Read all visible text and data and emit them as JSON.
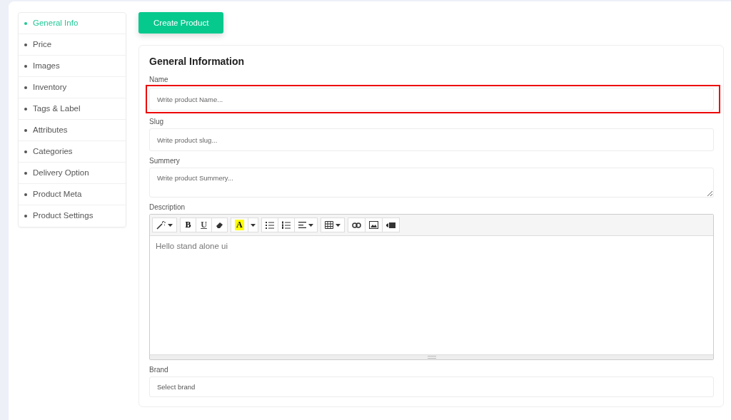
{
  "sidebar": {
    "items": [
      {
        "label": "General Info",
        "selected": true
      },
      {
        "label": "Price",
        "selected": false
      },
      {
        "label": "Images",
        "selected": false
      },
      {
        "label": "Inventory",
        "selected": false
      },
      {
        "label": "Tags & Label",
        "selected": false
      },
      {
        "label": "Attributes",
        "selected": false
      },
      {
        "label": "Categories",
        "selected": false
      },
      {
        "label": "Delivery Option",
        "selected": false
      },
      {
        "label": "Product Meta",
        "selected": false
      },
      {
        "label": "Product Settings",
        "selected": false
      }
    ]
  },
  "create_button": "Create Product",
  "form": {
    "title": "General Information",
    "fields": [
      {
        "kind": "input",
        "label": "Name",
        "placeholder": "Write product Name...",
        "highlighted": true
      },
      {
        "kind": "input",
        "label": "Slug",
        "placeholder": "Write product slug...",
        "highlighted": false
      },
      {
        "kind": "textarea",
        "label": "Summery",
        "placeholder": "Write product Summery...",
        "highlighted": false
      },
      {
        "kind": "editor",
        "label": "Description",
        "value": "Hello stand alone ui",
        "highlighted": false,
        "toolbar": [
          [
            {
              "kind": "magic",
              "caret": true
            }
          ],
          [
            {
              "kind": "bold",
              "label": "B"
            },
            {
              "kind": "underline",
              "label": "U"
            },
            {
              "kind": "eraser"
            }
          ],
          [
            {
              "kind": "color",
              "label": "A"
            },
            {
              "kind": "caret"
            }
          ],
          [
            {
              "kind": "ul"
            },
            {
              "kind": "ol"
            },
            {
              "kind": "align",
              "caret": true
            }
          ],
          [
            {
              "kind": "table",
              "caret": true
            }
          ],
          [
            {
              "kind": "link"
            },
            {
              "kind": "image"
            },
            {
              "kind": "video"
            }
          ]
        ]
      },
      {
        "kind": "select",
        "label": "Brand",
        "value": "Select brand",
        "highlighted": false
      }
    ]
  }
}
